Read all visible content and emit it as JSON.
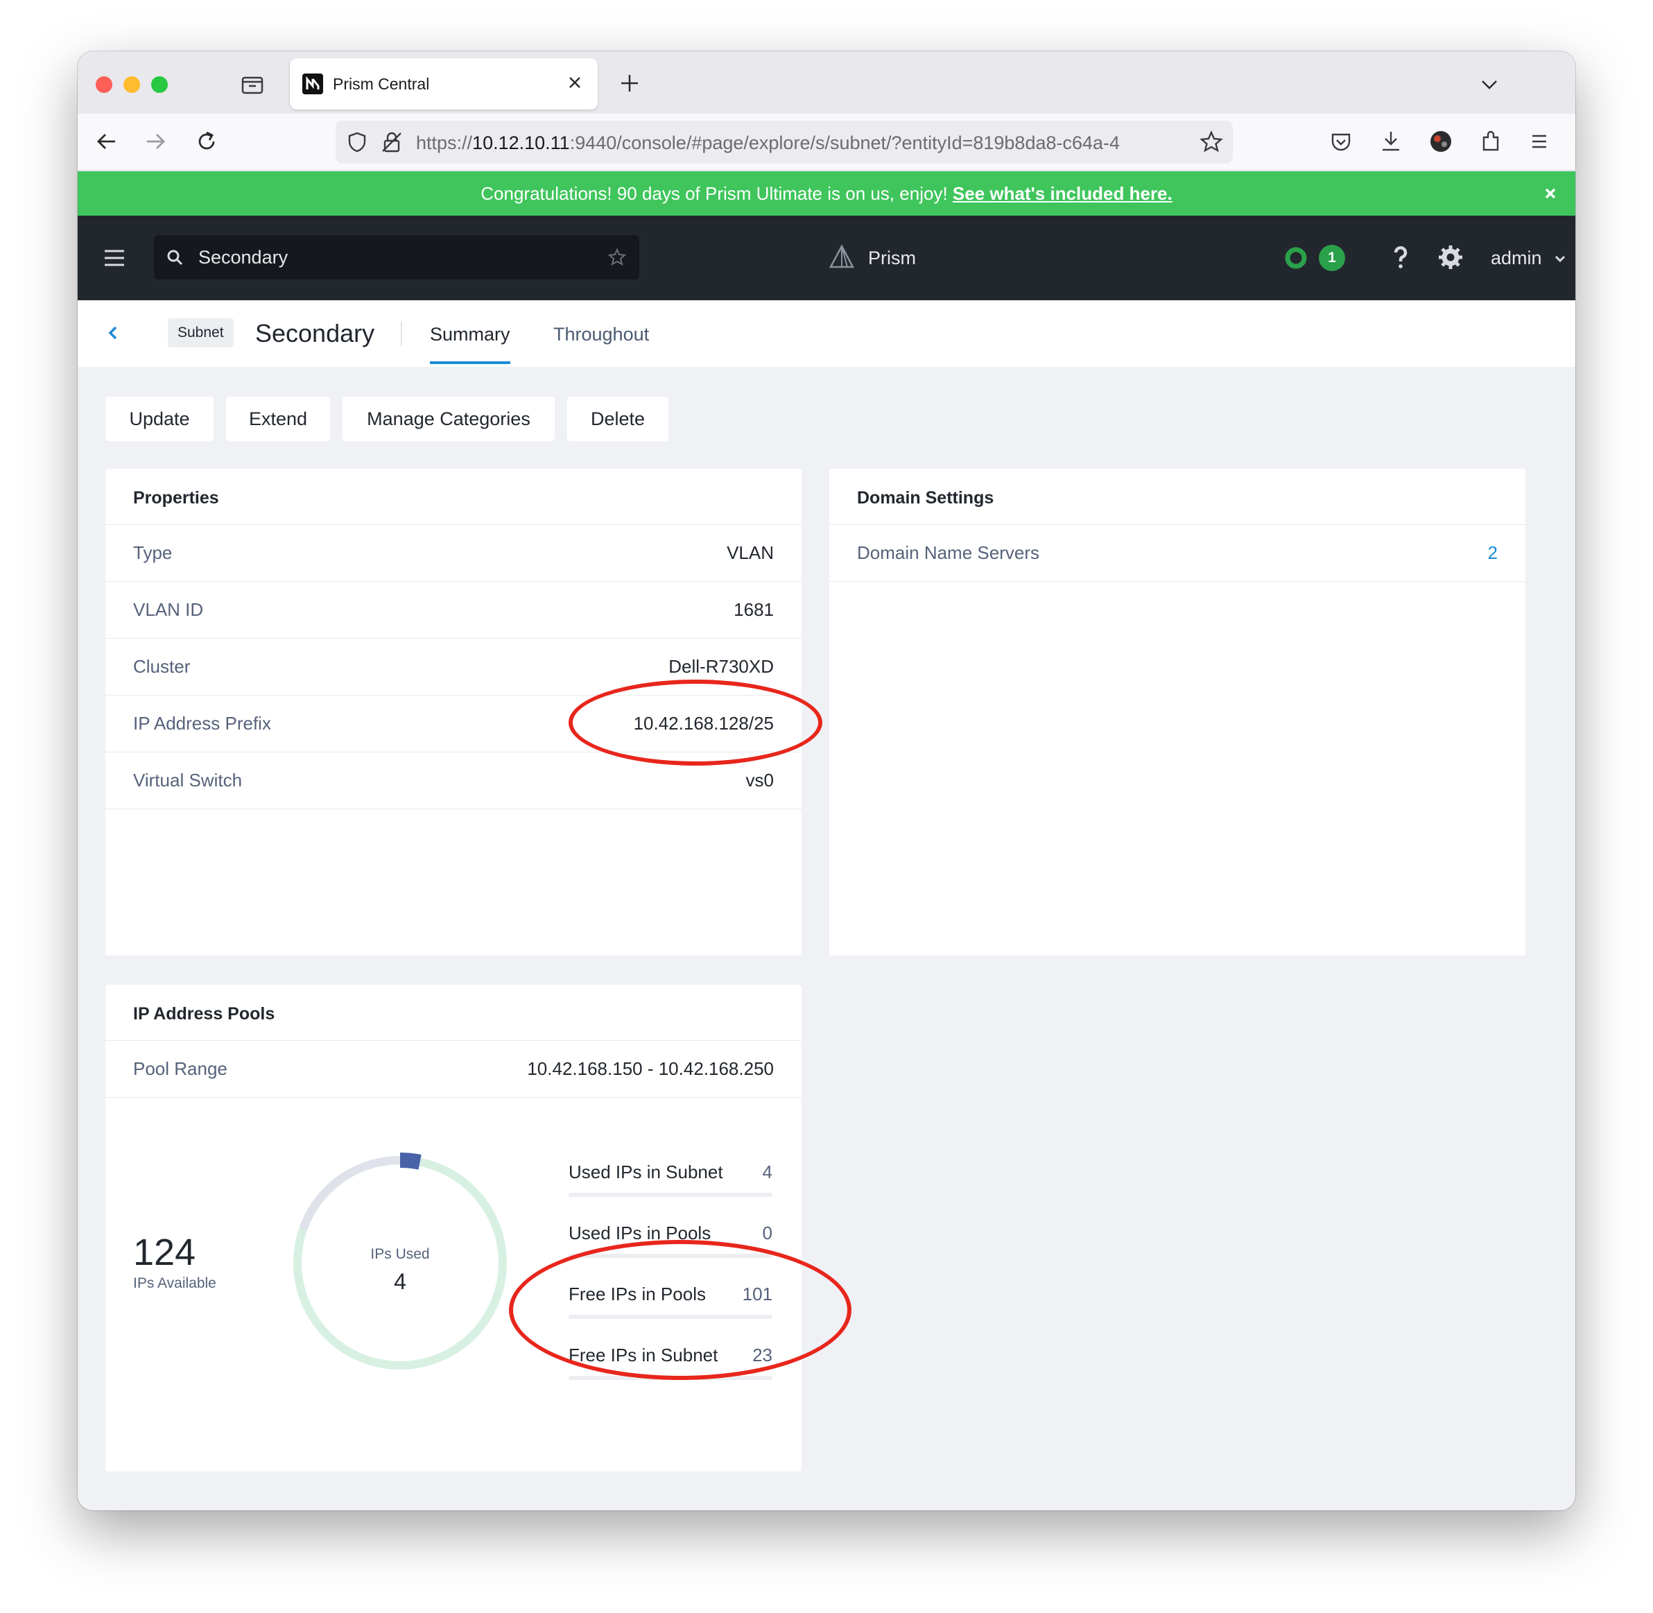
{
  "browser": {
    "tab_title": "Prism Central",
    "url_prefix": "https://",
    "url_host": "10.12.10.11",
    "url_rest": ":9440/console/#page/explore/s/subnet/?entityId=819b8da8-c64a-4"
  },
  "banner": {
    "text": "Congratulations! 90 days of Prism Ultimate is on us, enjoy! ",
    "link": "See what's included here."
  },
  "header": {
    "search_value": "Secondary",
    "app_name": "Prism",
    "alert_count": "1",
    "user": "admin"
  },
  "entity": {
    "badge": "Subnet",
    "name": "Secondary",
    "tabs": [
      {
        "label": "Summary"
      },
      {
        "label": "Throughout"
      }
    ]
  },
  "actions": [
    {
      "label": "Update"
    },
    {
      "label": "Extend"
    },
    {
      "label": "Manage Categories"
    },
    {
      "label": "Delete"
    }
  ],
  "properties": {
    "title": "Properties",
    "rows": [
      {
        "label": "Type",
        "value": "VLAN"
      },
      {
        "label": "VLAN ID",
        "value": "1681"
      },
      {
        "label": "Cluster",
        "value": "Dell-R730XD"
      },
      {
        "label": "IP Address Prefix",
        "value": "10.42.168.128/25"
      },
      {
        "label": "Virtual Switch",
        "value": "vs0"
      }
    ]
  },
  "domain": {
    "title": "Domain Settings",
    "rows": [
      {
        "label": "Domain Name Servers",
        "value": "2"
      }
    ]
  },
  "pools": {
    "title": "IP Address Pools",
    "range_label": "Pool Range",
    "range_value": "10.42.168.150 - 10.42.168.250",
    "available": "124",
    "available_label": "IPs Available",
    "used_label": "IPs Used",
    "used": "4",
    "used_fraction": 0.031,
    "stats": [
      {
        "label": "Used IPs in Subnet",
        "value": "4"
      },
      {
        "label": "Used IPs in Pools",
        "value": "0"
      },
      {
        "label": "Free IPs in Pools",
        "value": "101"
      },
      {
        "label": "Free IPs in Subnet",
        "value": "23"
      }
    ]
  },
  "colors": {
    "banner": "#3fc55c",
    "header": "#22272e",
    "accent": "#1b8ad6",
    "annotation": "#e8261c",
    "donut_used": "#4a63a8",
    "donut_pool": "#dfe2ea",
    "donut_free": "#d7f0e2"
  }
}
